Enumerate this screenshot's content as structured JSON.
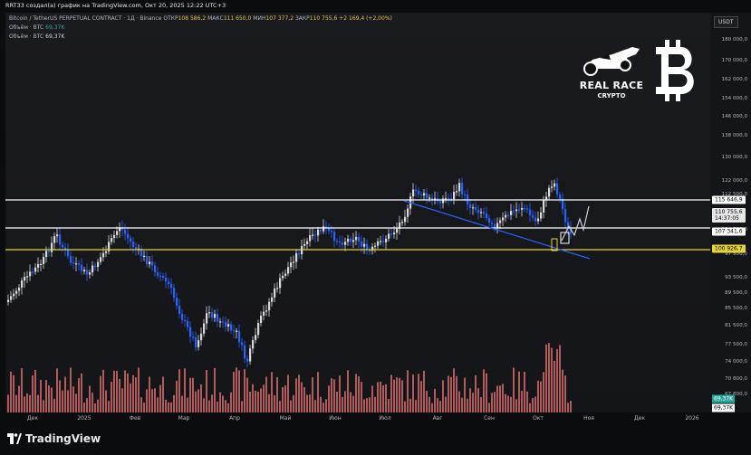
{
  "header": {
    "credit": "RRT33 создал(а) график на TradingView.com, Окт 20, 2025 12:22 UTC+3",
    "symbol": "Bitcoin / TetherUS PERPETUAL CONTRACT · 1Д · Binance",
    "open_label": "ОТКР",
    "open_value": "108 586,2",
    "high_label": "МАКС",
    "high_value": "111 650,0",
    "low_label": "МИН",
    "low_value": "107 377,2",
    "close_label": "ЗАКР",
    "close_value": "110 755,6",
    "change": "+2 169,4 (+2,00%)"
  },
  "volume_lines": [
    {
      "label": "Объём · BTC",
      "value": "69,37K"
    },
    {
      "label": "Объём · BTC",
      "value": "69,37K"
    }
  ],
  "currency_button": "USDT",
  "price_axis": [
    "180 000,0",
    "170 000,0",
    "162 000,0",
    "154 000,0",
    "146 000,0",
    "138 000,0",
    "130 000,0",
    "122 000,0",
    "112 500,0",
    "104 500,0",
    "97 500,0",
    "93 500,0",
    "89 500,0",
    "85 500,0",
    "81 500,0",
    "77 500,0",
    "74 000,0",
    "70 800,0",
    "67 800,0"
  ],
  "price_labels": {
    "line_upper": "115 646,9",
    "current": "110 755,6",
    "countdown": "14:37:05",
    "line_middle": "107 341,6",
    "line_yellow": "100 926,7",
    "vol_badge_1": "69,37K",
    "vol_badge_2": "69,37K"
  },
  "time_axis": [
    "Дек",
    "2025",
    "Фев",
    "Мар",
    "Апр",
    "Май",
    "Июн",
    "Июл",
    "Авг",
    "Сен",
    "Окт",
    "Ноя",
    "Дек",
    "2026"
  ],
  "logo": {
    "line1": "REAL RACE",
    "line2": "CRYPTO"
  },
  "footer": {
    "brand": "TradingView"
  },
  "colors": {
    "up": "#d9d9d9",
    "down": "#2962ff",
    "level": "#ffffff",
    "support": "#e5d33a",
    "trend": "#2962ff",
    "volume": "#e57373"
  }
}
